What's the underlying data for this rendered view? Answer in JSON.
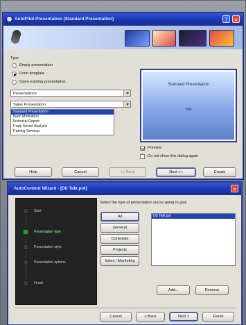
{
  "dialog1": {
    "title": "AutoPilot Presentation (Standard Presentation)",
    "type_label": "Type",
    "options": [
      {
        "label": "Empty presentation",
        "selected": false
      },
      {
        "label": "From template",
        "selected": true
      },
      {
        "label": "Open existing presentation",
        "selected": false
      }
    ],
    "combo1": {
      "value": "Presentations"
    },
    "combo2": {
      "value": "Sales Presentation"
    },
    "template_list": [
      {
        "label": "Standard Presentation",
        "selected": true
      },
      {
        "label": "Team Motivation",
        "selected": false
      },
      {
        "label": "Technical Report",
        "selected": false
      },
      {
        "label": "Trade Sector Analysis",
        "selected": false
      },
      {
        "label": "Training Seminar",
        "selected": false
      }
    ],
    "preview": {
      "slide_title": "Standard Presentation",
      "slide_sub": "Title"
    },
    "checkboxes": [
      {
        "label": "Preview",
        "checked": true
      },
      {
        "label": "Do not show this dialog again",
        "checked": false
      }
    ],
    "buttons": {
      "help": "Help",
      "cancel": "Cancel",
      "back": "<< Back",
      "next": "Next >>",
      "create": "Create"
    }
  },
  "dialog2": {
    "title": "AutoContent Wizard - [Db Talk.pot]",
    "prompt": "Select the type of presentation you're going to give",
    "categories": [
      "All",
      "General",
      "Corporate",
      "Projects",
      "Sales / Marketing"
    ],
    "list": [
      {
        "label": "Db Talk.pot",
        "selected": true
      }
    ],
    "left_panel_items": [
      {
        "label": "Start",
        "accent": false
      },
      {
        "label": "Presentation type",
        "accent": true
      },
      {
        "label": "Presentation style",
        "accent": false
      },
      {
        "label": "Presentation options",
        "accent": false
      },
      {
        "label": "Finish",
        "accent": false
      }
    ],
    "buttons": {
      "add": "Add...",
      "remove": "Remove",
      "cancel": "Cancel",
      "back": "< Back",
      "next": "Next >",
      "finish": "Finish"
    }
  }
}
